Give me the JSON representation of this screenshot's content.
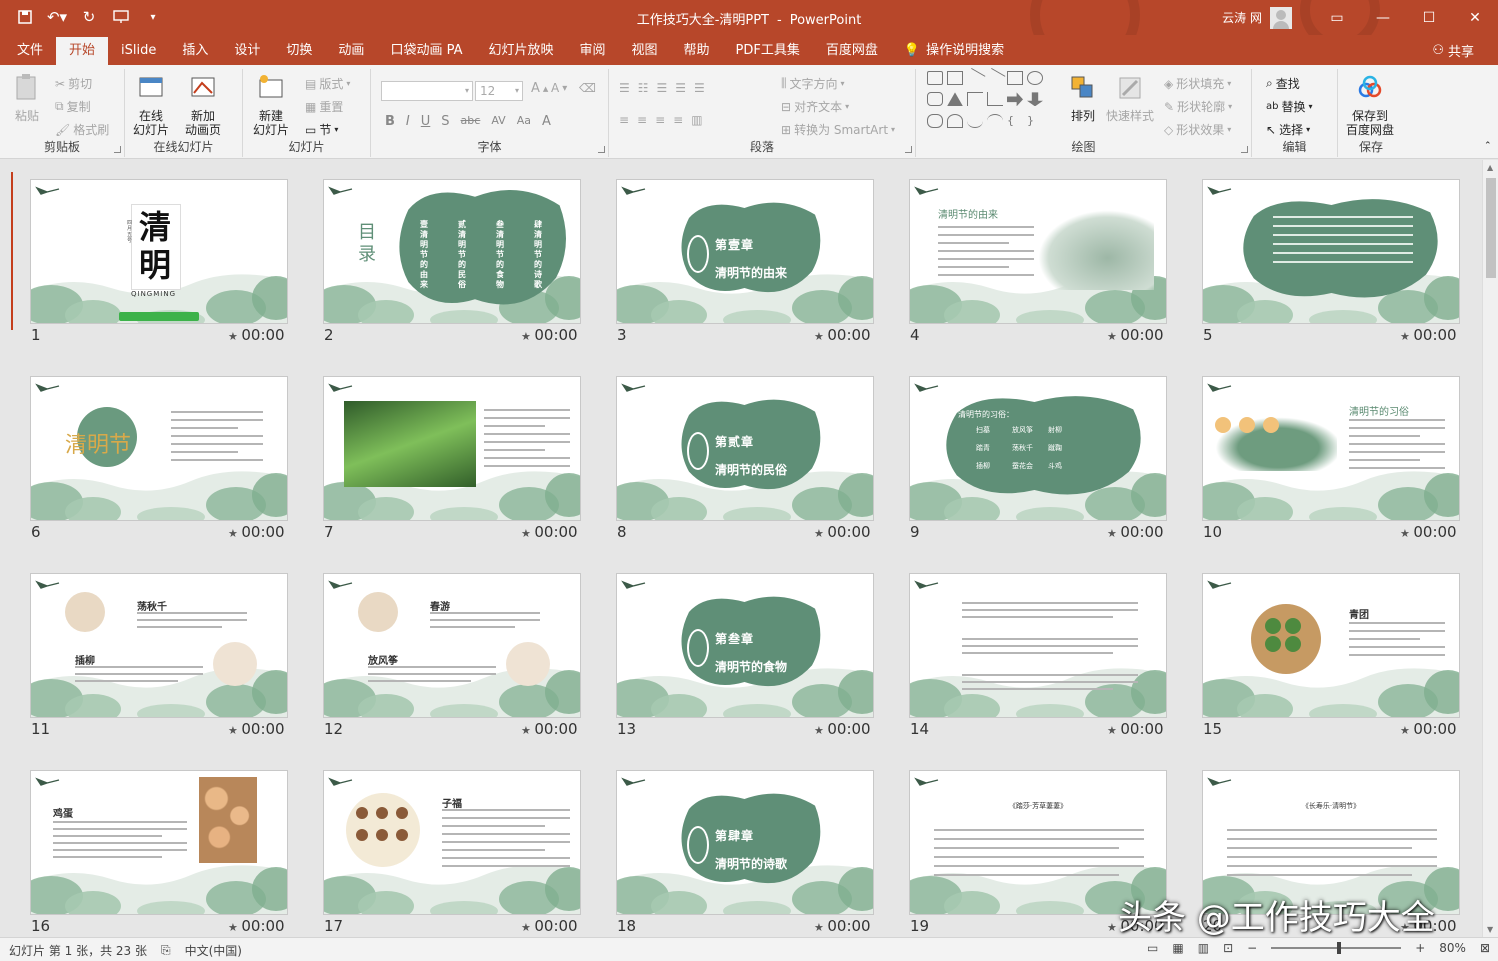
{
  "colors": {
    "accent": "#b7472a",
    "ink": "#5f8f77",
    "leaf": "#8fb99c",
    "text": "#262626"
  },
  "title_bar": {
    "document": "工作技巧大全-清明PPT",
    "separator": "-",
    "app": "PowerPoint",
    "user": "云涛 网",
    "qat_icons": [
      "save-icon",
      "undo-icon",
      "redo-icon",
      "presentation-start-icon",
      "customize-icon"
    ],
    "win_icons": [
      "ribbon-display-icon",
      "minimize-icon",
      "maximize-icon",
      "close-icon"
    ]
  },
  "tabs": [
    "文件",
    "开始",
    "iSlide",
    "插入",
    "设计",
    "切换",
    "动画",
    "口袋动画 PA",
    "幻灯片放映",
    "审阅",
    "视图",
    "帮助",
    "PDF工具集",
    "百度网盘"
  ],
  "active_tab": "开始",
  "tell_me": "操作说明搜索",
  "share": "共享",
  "ribbon": {
    "clipboard": {
      "label": "剪贴板",
      "paste": "粘贴",
      "cut": "剪切",
      "copy": "复制",
      "format_painter": "格式刷"
    },
    "online_slides": {
      "label": "在线幻灯片",
      "online_slide": "在线\n幻灯片",
      "new_anim": "新加\n动画页"
    },
    "slides": {
      "label": "幻灯片",
      "new_slide": "新建\n幻灯片",
      "layout": "版式",
      "reset": "重置",
      "section": "节"
    },
    "font": {
      "label": "字体",
      "size": "12",
      "buttons": [
        "B",
        "I",
        "U",
        "S",
        "abc",
        "AV",
        "Aa",
        "A"
      ]
    },
    "paragraph": {
      "label": "段落",
      "text_direction": "文字方向",
      "align_text": "对齐文本",
      "smartart": "转换为 SmartArt"
    },
    "drawing": {
      "label": "绘图",
      "arrange": "排列",
      "quick_styles": "快速样式",
      "fill": "形状填充",
      "outline": "形状轮廓",
      "effects": "形状效果"
    },
    "editing": {
      "label": "编辑",
      "find": "查找",
      "replace": "替换",
      "select": "选择"
    },
    "save": {
      "label": "保存",
      "save_to_baidu": "保存到\n百度网盘"
    }
  },
  "slides": [
    {
      "n": "1",
      "time": "00:00",
      "kind": "cover",
      "title": "清明",
      "sub": "QINGMING",
      "side": "四月五号"
    },
    {
      "n": "2",
      "time": "00:00",
      "kind": "toc",
      "title": "目录",
      "cols": [
        "壹 清明节的由来",
        "贰 清明节的民俗",
        "叁 清明节的食物",
        "肆 清明节的诗歌"
      ]
    },
    {
      "n": "3",
      "time": "00:00",
      "kind": "chapter",
      "ch": "第壹章",
      "sub": "清明节的由来"
    },
    {
      "n": "4",
      "time": "00:00",
      "kind": "text-right-img",
      "heading": "清明节的由来"
    },
    {
      "n": "5",
      "time": "00:00",
      "kind": "ink-text"
    },
    {
      "n": "6",
      "time": "00:00",
      "kind": "circle-text",
      "big": "清明节"
    },
    {
      "n": "7",
      "time": "00:00",
      "kind": "photo-text"
    },
    {
      "n": "8",
      "time": "00:00",
      "kind": "chapter",
      "ch": "第贰章",
      "sub": "清明节的民俗"
    },
    {
      "n": "9",
      "time": "00:00",
      "kind": "customs",
      "heading": "清明节的习俗：",
      "items": [
        "扫墓",
        "放风筝",
        "射柳",
        "踏青",
        "荡秋千",
        "蹴鞠",
        "插柳",
        "蚕花会",
        "斗鸡"
      ]
    },
    {
      "n": "10",
      "time": "00:00",
      "kind": "kids",
      "heading": "清明节的习俗"
    },
    {
      "n": "11",
      "time": "00:00",
      "kind": "two-circles",
      "h1": "荡秋千",
      "h2": "插柳"
    },
    {
      "n": "12",
      "time": "00:00",
      "kind": "two-circles-b",
      "h1": "春游",
      "h2": "放风筝"
    },
    {
      "n": "13",
      "time": "00:00",
      "kind": "chapter",
      "ch": "第叁章",
      "sub": "清明节的食物"
    },
    {
      "n": "14",
      "time": "00:00",
      "kind": "bullets"
    },
    {
      "n": "15",
      "time": "00:00",
      "kind": "food",
      "heading": "青团"
    },
    {
      "n": "16",
      "time": "00:00",
      "kind": "eggs",
      "heading": "鸡蛋"
    },
    {
      "n": "17",
      "time": "00:00",
      "kind": "cookies",
      "heading": "子福"
    },
    {
      "n": "18",
      "time": "00:00",
      "kind": "chapter",
      "ch": "第肆章",
      "sub": "清明节的诗歌"
    },
    {
      "n": "19",
      "time": "00:00",
      "kind": "poem",
      "heading": "《踏莎·芳草萋萋》"
    },
    {
      "n": "20",
      "time": "00:00",
      "kind": "poem",
      "heading": "《长寿乐·清明节》"
    }
  ],
  "status": {
    "slide_info": "幻灯片 第 1 张，共 23 张",
    "language": "中文(中国)",
    "zoom": "80%",
    "zoom_fraction": 0.52
  },
  "watermark": "头条 @工作技巧大全"
}
